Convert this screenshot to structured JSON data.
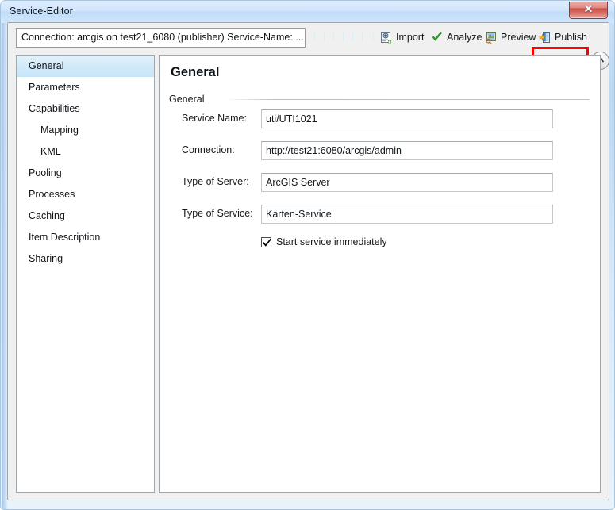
{
  "window": {
    "title": "Service-Editor",
    "close_label": "✕"
  },
  "toolbar": {
    "connection_text": "Connection: arcgis on  test21_6080 (publisher)  Service-Name: ...",
    "import_label": "Import",
    "analyze_label": "Analyze",
    "preview_label": "Preview",
    "publish_label": "Publish",
    "highlight_color": "#ff0000"
  },
  "sidebar": {
    "items": [
      {
        "label": "General",
        "indent": false,
        "selected": true
      },
      {
        "label": "Parameters",
        "indent": false,
        "selected": false
      },
      {
        "label": "Capabilities",
        "indent": false,
        "selected": false
      },
      {
        "label": "Mapping",
        "indent": true,
        "selected": false
      },
      {
        "label": "KML",
        "indent": true,
        "selected": false
      },
      {
        "label": "Pooling",
        "indent": false,
        "selected": false
      },
      {
        "label": "Processes",
        "indent": false,
        "selected": false
      },
      {
        "label": "Caching",
        "indent": false,
        "selected": false
      },
      {
        "label": "Item Description",
        "indent": false,
        "selected": false
      },
      {
        "label": "Sharing",
        "indent": false,
        "selected": false
      }
    ]
  },
  "main": {
    "page_title": "General",
    "group_label": "General",
    "fields": [
      {
        "label": "Service Name:",
        "value": "uti/UTI1021"
      },
      {
        "label": "Connection:",
        "value": "http://test21:6080/arcgis/admin"
      },
      {
        "label": "Type of Server:",
        "value": "ArcGIS Server"
      },
      {
        "label": "Type of Service:",
        "value": "Karten-Service"
      }
    ],
    "checkbox": {
      "label": "Start service immediately",
      "checked": true
    }
  }
}
